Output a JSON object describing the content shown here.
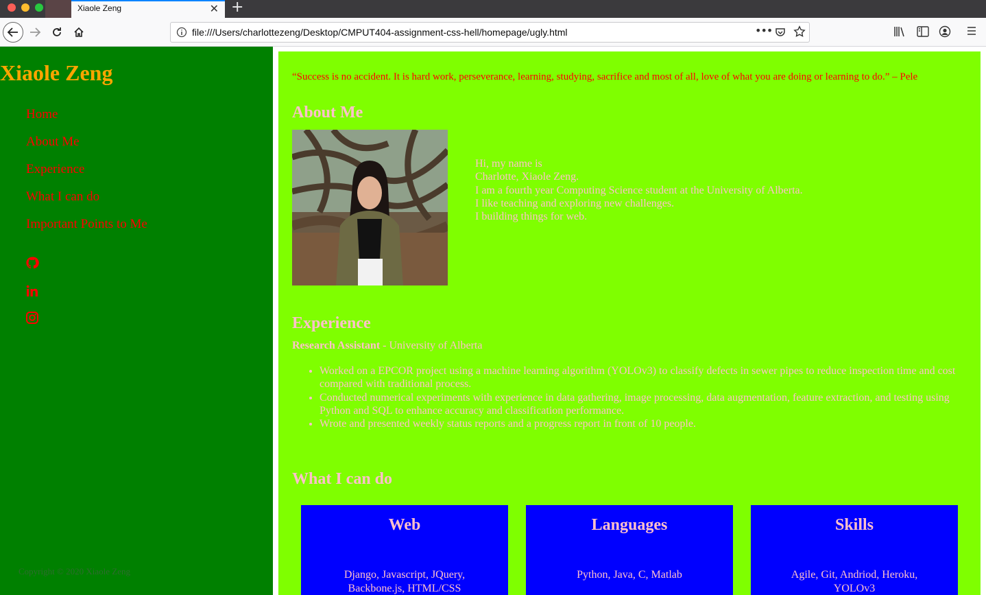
{
  "browser": {
    "tab_title": "Xiaole Zeng",
    "url": "file:///Users/charlottezeng/Desktop/CMPUT404-assignment-css-hell/homepage/ugly.html"
  },
  "sidebar": {
    "site_title": "Xiaole Zeng",
    "nav": [
      "Home",
      "About Me",
      "Experience",
      "What I can do",
      "Important Points to Me"
    ],
    "social_icons": [
      "github-icon",
      "linkedin-icon",
      "instagram-icon"
    ],
    "copyright": "Copyright © 2020 Xiaole Zeng"
  },
  "main": {
    "quote": "“Success is no accident. It is hard work, perseverance, learning, studying, sacrifice and most of all, love of what you are doing or learning to do.” – Pele",
    "about": {
      "heading": "About Me",
      "bio_lines": [
        "Hi, my name is",
        "Charlotte, Xiaole Zeng.",
        "I am a fourth year Computing Science student at the University of Alberta.",
        "I like teaching and exploring new challenges.",
        "I building things for web."
      ]
    },
    "experience": {
      "heading": "Experience",
      "role": "Research Assistant",
      "org": " - University of Alberta",
      "bullets": [
        "Worked on a EPCOR project using a machine learning algorithm (YOLOv3) to classify defects in sewer pipes to reduce inspection time and cost compared with traditional process.",
        "Conducted numerical experiments with experience in data gathering, image processing, data augmentation, feature extraction, and testing using Python and SQL to enhance accuracy and classification performance.",
        "Wrote and presented weekly status reports and a progress report in front of 10 people."
      ]
    },
    "can_do": {
      "heading": "What I can do",
      "cards": [
        {
          "title": "Web",
          "body": "Django, Javascript, JQuery, Backbone.js, HTML/CSS"
        },
        {
          "title": "Languages",
          "body": "Python, Java, C, Matlab"
        },
        {
          "title": "Skills",
          "body": "Agile, Git, Andriod, Heroku, YOLOv3"
        }
      ]
    }
  },
  "colors": {
    "sidebar_bg": "#008000",
    "title": "#ffa500",
    "nav_link": "#ff0000",
    "main_bg": "#7fff00",
    "text_pink": "#ffc0cb",
    "card_bg": "#0000ff"
  }
}
